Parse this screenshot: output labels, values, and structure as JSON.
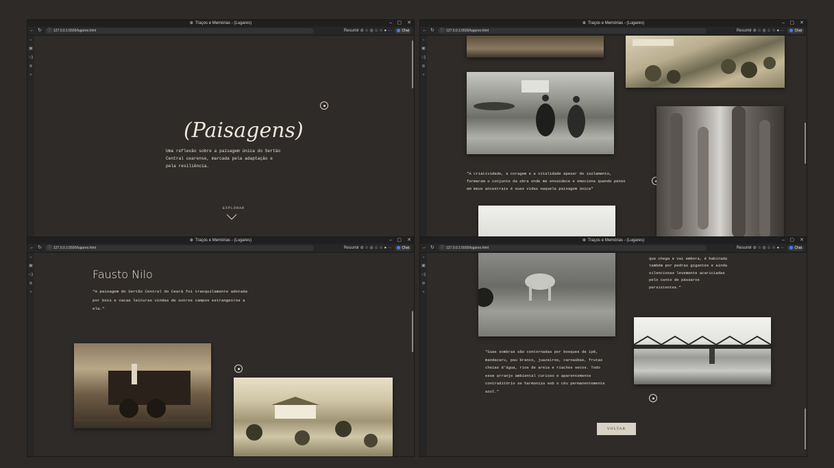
{
  "window": {
    "title": "Traços e Memórias - (Lugares)",
    "url": "127.0.0.1:5500/lugares.html",
    "resumir_label": "Resumir",
    "chat_label": "Chat",
    "controls": {
      "minimize": "–",
      "maximize": "▢",
      "close": "✕"
    }
  },
  "panel1": {
    "heading": "(Paisagens)",
    "description": "Uma reflexão sobre a paisagem única do Sertão Central cearense, marcada pela adaptação e pela resiliência.",
    "explore_label": "EXPLORAR"
  },
  "panel2": {
    "quote": "\"A criatividade, a coragem e a vitalidade apesar do isolamento, formaram o conjunto da obra onde me envaidece e emociona quando penso em meus ancestrais é suas vidas naquela paisagem única\""
  },
  "panel3": {
    "author": "Fausto Nilo",
    "quote": "\"A paisagem do Sertão Central do Ceará foi tranquilamente adotada por bois e vacas leituras vindas de outros campos estrangeiros a ela.\""
  },
  "panel4": {
    "poem_top": "que chega e vai embora, é habitada também por pedras gigantes e ainda silenciosas levemente acariciadas pelo canto de pássaros persistentes.\"",
    "quote": "\"Suas sombras são contornadas por bosques de ipê, mandacaru, pau branco, juazeiros, carnaúbas, frutas cheias d'água, rios de areia e riachos secos. Todo esse arranjo ambiental curioso e aparentemente contraditório se harmoniza sob o céu permanentemente azul.\"",
    "back_label": "VOLTAR"
  },
  "colors": {
    "page_bg": "#2f2b28",
    "text": "#e6e0d8",
    "frame": "#2e2a27"
  }
}
